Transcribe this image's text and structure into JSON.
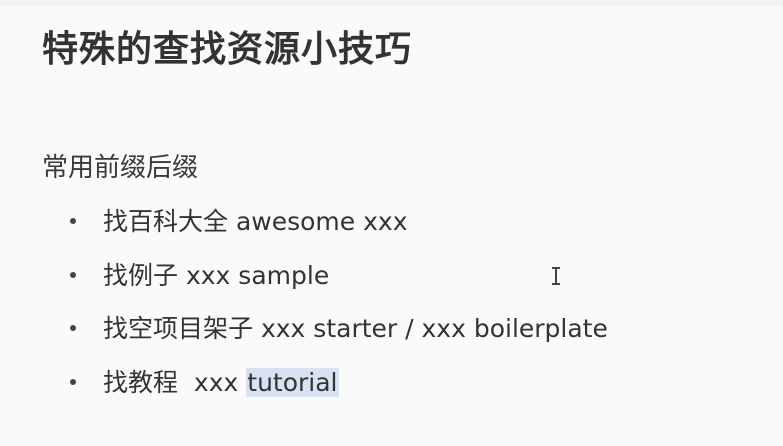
{
  "document": {
    "title": "特殊的查找资源小技巧",
    "section": {
      "heading": "常用前缀后缀",
      "items": [
        {
          "label": "找百科大全",
          "code": "awesome xxx",
          "highlight": ""
        },
        {
          "label": "找例子",
          "code": "xxx sample",
          "highlight": ""
        },
        {
          "label": "找空项目架子",
          "code": "xxx starter / xxx boilerplate",
          "highlight": ""
        },
        {
          "label": "找教程",
          "code": "xxx",
          "highlight": "tutorial"
        }
      ]
    }
  },
  "ui": {
    "cursor_icon": "text-cursor-icon",
    "highlight_color": "#d7e3f3",
    "text_color": "#333333",
    "background_color": "#fafafa"
  }
}
